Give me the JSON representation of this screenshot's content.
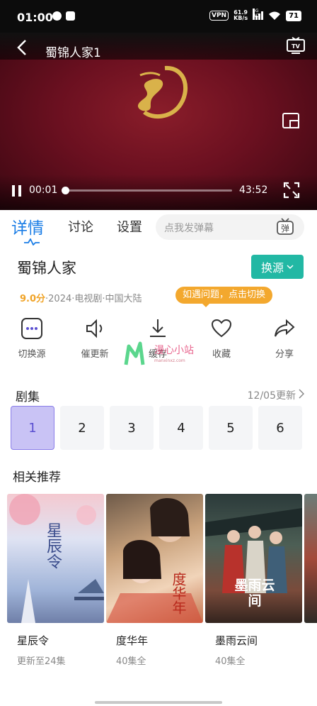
{
  "status_bar": {
    "time": "01:00",
    "vpn": "VPN",
    "speed_value": "61.9",
    "speed_unit": "KB/s",
    "signal_label": "5G HD",
    "battery": "71"
  },
  "player": {
    "title": "蜀锦人家1",
    "current_time": "00:01",
    "total_time": "43:52",
    "progress_fraction": 0.0
  },
  "tabs": [
    {
      "label": "详情"
    },
    {
      "label": "讨论"
    },
    {
      "label": "设置"
    }
  ],
  "danmu": {
    "placeholder": "点我发弹幕",
    "icon_char": "弹"
  },
  "show": {
    "title": "蜀锦人家",
    "switch_source": "换源",
    "score": "9.0分",
    "meta": "·2024·电视剧·中国大陆",
    "tip": "如遇问题，点击切换"
  },
  "actions": [
    {
      "label": "切换源",
      "icon": "more-dots-icon"
    },
    {
      "label": "催更新",
      "icon": "speaker-icon"
    },
    {
      "label": "缓存",
      "icon": "download-icon"
    },
    {
      "label": "收藏",
      "icon": "heart-icon"
    },
    {
      "label": "分享",
      "icon": "share-icon"
    }
  ],
  "watermark": {
    "text": "漫心小站",
    "sub": "manxinxz.com"
  },
  "episodes": {
    "heading": "剧集",
    "update": "12/05更新",
    "items": [
      "1",
      "2",
      "3",
      "4",
      "5",
      "6"
    ],
    "selected": "1"
  },
  "recommendations": {
    "heading": "相关推荐",
    "items": [
      {
        "title": "星辰令",
        "subtitle": "更新至24集",
        "poster_text": "星辰令"
      },
      {
        "title": "度华年",
        "subtitle": "40集全",
        "poster_text": "度华年"
      },
      {
        "title": "墨雨云间",
        "subtitle": "40集全",
        "poster_text": "墨雨云间"
      }
    ]
  },
  "colors": {
    "accent": "#1a7de6",
    "switch_button": "#22b8a4",
    "tip": "#f3a82e",
    "score": "#f0a326",
    "selected_episode": "#c9c3f5"
  }
}
